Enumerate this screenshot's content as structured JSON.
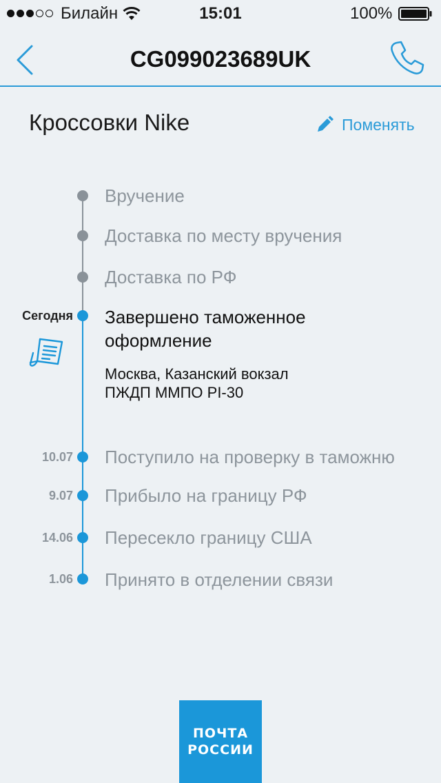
{
  "status_bar": {
    "carrier": "Билайн",
    "time": "15:01",
    "battery": "100%",
    "signal_bars_filled": 3,
    "signal_bars_total": 5
  },
  "nav": {
    "title": "CG099023689UK",
    "back_icon": "chevron-left-icon",
    "call_icon": "phone-icon"
  },
  "parcel": {
    "name": "Кроссовки Nike",
    "edit_label": "Поменять",
    "edit_icon": "pencil-icon"
  },
  "upcoming": [
    {
      "label": "Вручение"
    },
    {
      "label": "Доставка по месту вручения"
    },
    {
      "label": "Доставка по РФ"
    }
  ],
  "current": {
    "date": "Сегодня",
    "label": "Завершено таможенное оформление",
    "address_line1": "Москва, Казанский вокзал",
    "address_line2": "ПЖДП ММПО PI-30",
    "icon": "customs-document-icon"
  },
  "history": [
    {
      "date": "10.07",
      "label": "Поступило на проверку в таможню"
    },
    {
      "date": "9.07",
      "label": "Прибыло на границу РФ"
    },
    {
      "date": "14.06",
      "label": "Пересекло границу США"
    },
    {
      "date": "1.06",
      "label": "Принято в отделении связи"
    }
  ],
  "logo": {
    "line1": "ПОЧТА",
    "line2": "РОССИИ"
  },
  "colors": {
    "accent": "#1b97d9",
    "background": "#edf1f4",
    "pending": "#8a9299"
  }
}
